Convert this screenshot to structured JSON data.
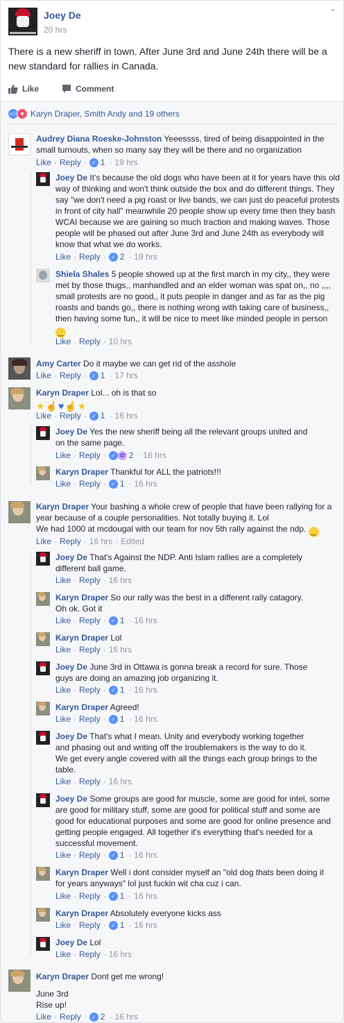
{
  "post": {
    "author": "Joey De",
    "time": "20 hrs",
    "text": "There is a new sheriff in town. After June 3rd and June 24th there will be a new standard for rallies in Canada.",
    "actions": {
      "like": "Like",
      "comment": "Comment"
    },
    "reactions": "Karyn Draper, Smith Andy and 19 others"
  },
  "labels": {
    "like": "Like",
    "reply": "Reply",
    "edited": "Edited"
  },
  "comments": [
    {
      "name": "Audrey Diana Roeske-Johnston",
      "text": "Yeeessss, tired of being disappointed in the small turnouts, when so many say they will be there and no organization",
      "likes": "1",
      "time": "19 hrs"
    },
    {
      "name": "Joey De",
      "text": "It's because the old dogs who have been at it for years have this old way of thinking and won't think outside the box and do different things. They say \"we don't need a pig roast or live bands, we can just do peaceful protests in front of city hall\" meanwhile 20 people show up every time then they bash WCAI because we are gaining so much traction and making waves. Those people will be phased out after June 3rd and June 24th as everybody will know that what we do works.",
      "likes": "2",
      "time": "19 hrs"
    },
    {
      "name": "Shiela Shales",
      "text": "5 people showed up at the first march in my city,, they were met by those thugs,, manhandled and an elder woman was spat on,, no ,,,, small protests are no good,, it puts people in danger and as far as the pig roasts and bands go,, there is nothing wrong with taking care of business,, then having some fun,, it will be nice to meet like minded people in person",
      "likes": "",
      "time": "10 hrs"
    },
    {
      "name": "Amy Carter",
      "text": "Do it maybe we can get rid of the asshole",
      "likes": "1",
      "time": "17 hrs"
    },
    {
      "name": "Karyn Draper",
      "text": "Lol... oh is that so",
      "likes": "1",
      "time": "16 hrs"
    },
    {
      "name": "Joey De",
      "text": "Yes the new sheriff being all the relevant groups united and on the same page.",
      "likes": "2",
      "time": "16 hrs"
    },
    {
      "name": "Karyn Draper",
      "text": "Thankful for ALL the patriots!!!",
      "likes": "1",
      "time": "16 hrs"
    },
    {
      "name": "Karyn Draper",
      "text": "Your bashing a whole crew of people that have been rallying for a year because of a couple personalities. Not totally buying it. Lol",
      "text2": "We had 1000 at mcdougal with our team for nov 5th rally against the ndp.",
      "likes": "",
      "time": "16 hrs"
    },
    {
      "name": "Joey De",
      "text": "That's Against the NDP. Anti Islam rallies are a completely different ball game.",
      "likes": "",
      "time": "16 hrs"
    },
    {
      "name": "Karyn Draper",
      "text": "So our rally was the best in a different rally catagory.",
      "text2": "Oh ok. Got it",
      "likes": "1",
      "time": "16 hrs"
    },
    {
      "name": "Karyn Draper",
      "text": "Lol",
      "likes": "",
      "time": "16 hrs"
    },
    {
      "name": "Joey De",
      "text": "June 3rd in Ottawa is gonna break a record for sure. Those guys are doing an amazing job organizing it.",
      "likes": "1",
      "time": "16 hrs"
    },
    {
      "name": "Karyn Draper",
      "text": "Agreed!",
      "likes": "1",
      "time": "16 hrs"
    },
    {
      "name": "Joey De",
      "text": "That's what I mean. Unity and everybody working together and phasing out and writing off the troublemakers is the way to do it. We get every angle covered with all the things each group brings to the table.",
      "likes": "",
      "time": "16 hrs"
    },
    {
      "name": "Joey De",
      "text": "Some groups are good for muscle, some are good for intel, some are good for military stuff, some are good for political stuff and some are good for educational purposes and some are good for online presence and getting people engaged. All together it's everything that's needed for a successful movement.",
      "likes": "1",
      "time": "16 hrs"
    },
    {
      "name": "Karyn Draper",
      "text": "Well i dont consider myself an \"old dog thats been doing it for years anyways\" lol just fuckin wit cha cuz i can.",
      "likes": "1",
      "time": "16 hrs"
    },
    {
      "name": "Karyn Draper",
      "text": "Absolutely everyone kicks ass",
      "likes": "1",
      "time": "16 hrs"
    },
    {
      "name": "Joey De",
      "text": "Lol",
      "likes": "",
      "time": "16 hrs"
    },
    {
      "name": "Karyn Draper",
      "text": "Dont get me wrong!",
      "text2": "June 3rd",
      "text3": "Rise up!",
      "likes": "2",
      "time": "16 hrs"
    }
  ]
}
